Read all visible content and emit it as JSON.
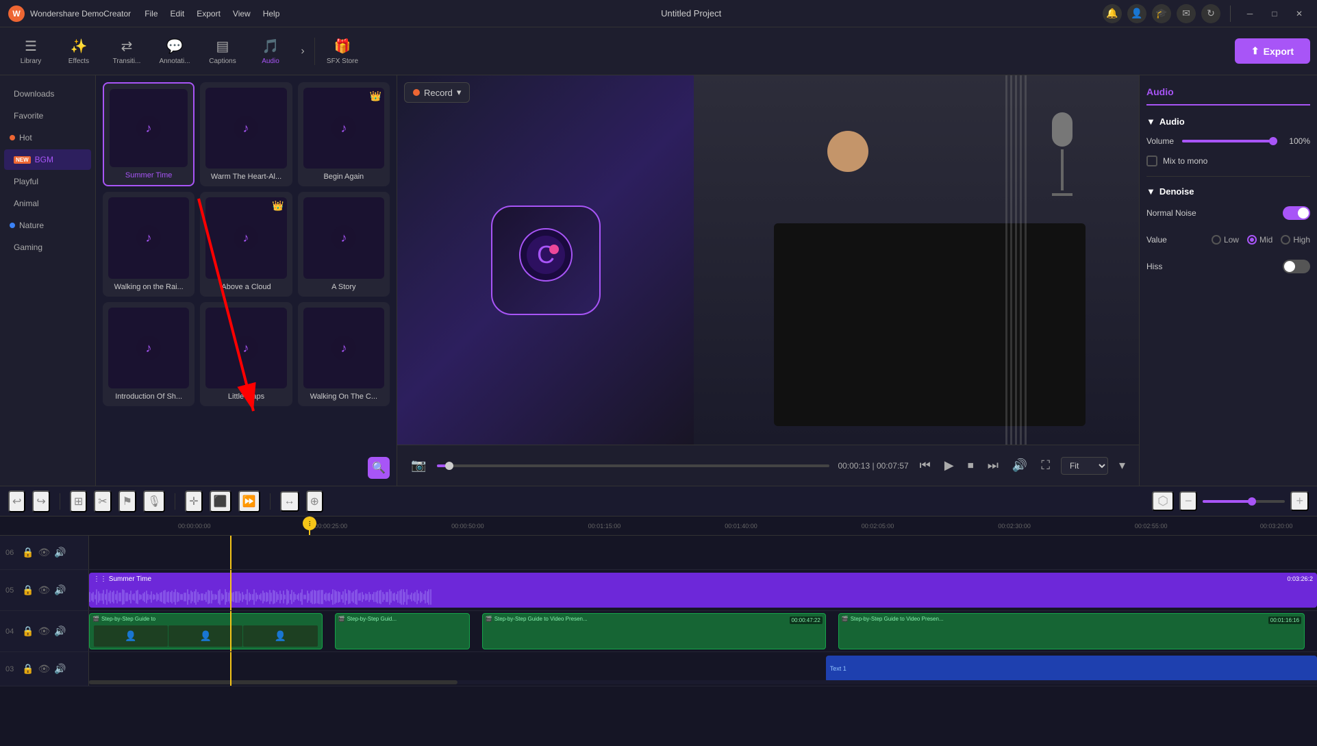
{
  "app": {
    "name": "Wondershare DemoCreator",
    "title": "Untitled Project"
  },
  "titlebar": {
    "menus": [
      "File",
      "Edit",
      "Export",
      "View",
      "Help"
    ],
    "controls": [
      "notification",
      "account",
      "education",
      "mail",
      "refresh"
    ]
  },
  "toolbar": {
    "items": [
      {
        "id": "library",
        "label": "Library",
        "icon": "☰"
      },
      {
        "id": "effects",
        "label": "Effects",
        "icon": "✨"
      },
      {
        "id": "transitions",
        "label": "Transiti...",
        "icon": "⇄"
      },
      {
        "id": "annotations",
        "label": "Annotati...",
        "icon": "💬"
      },
      {
        "id": "captions",
        "label": "Captions",
        "icon": "▤"
      },
      {
        "id": "audio",
        "label": "Audio",
        "icon": "🎵"
      },
      {
        "id": "sfx",
        "label": "SFX Store",
        "icon": "🎁"
      }
    ],
    "export_label": "Export"
  },
  "sidebar": {
    "items": [
      {
        "id": "downloads",
        "label": "Downloads",
        "badge": null
      },
      {
        "id": "favorite",
        "label": "Favorite",
        "badge": null
      },
      {
        "id": "hot",
        "label": "Hot",
        "badge": "dot"
      },
      {
        "id": "bgm",
        "label": "BGM",
        "badge": "new"
      },
      {
        "id": "playful",
        "label": "Playful",
        "badge": null
      },
      {
        "id": "animal",
        "label": "Animal",
        "badge": null
      },
      {
        "id": "nature",
        "label": "Nature",
        "badge": "blue"
      },
      {
        "id": "gaming",
        "label": "Gaming",
        "badge": null
      }
    ]
  },
  "audio_cards": [
    {
      "id": "summer-time",
      "label": "Summer Time",
      "selected": true,
      "crown": false
    },
    {
      "id": "warm-the-heart",
      "label": "Warm The Heart-Al...",
      "selected": false,
      "crown": false
    },
    {
      "id": "begin-again",
      "label": "Begin Again",
      "selected": false,
      "crown": true
    },
    {
      "id": "walking-on-the-rain",
      "label": "Walking on the Rai...",
      "selected": false,
      "crown": false
    },
    {
      "id": "above-a-cloud",
      "label": "Above a Cloud",
      "selected": false,
      "crown": true
    },
    {
      "id": "a-story",
      "label": "A Story",
      "selected": false,
      "crown": false
    },
    {
      "id": "introduction-of-sh",
      "label": "Introduction Of Sh...",
      "selected": false,
      "crown": false
    },
    {
      "id": "little-maps",
      "label": "Little Maps",
      "selected": false,
      "crown": false
    },
    {
      "id": "walking-on-the-c",
      "label": "Walking On The C...",
      "selected": false,
      "crown": false
    }
  ],
  "preview": {
    "record_label": "Record",
    "timestamp_current": "00:00:13",
    "timestamp_total": "00:07:57",
    "fit_label": "Fit"
  },
  "right_panel": {
    "header": "Audio",
    "audio_section": {
      "title": "Audio",
      "volume_label": "Volume",
      "volume_value": "100%",
      "mix_to_mono_label": "Mix to mono"
    },
    "denoise_section": {
      "title": "Denoise",
      "normal_noise_label": "Normal Noise",
      "value_label": "Value",
      "value_options": [
        "Low",
        "Mid",
        "High"
      ],
      "value_selected": "Mid",
      "hiss_label": "Hiss"
    }
  },
  "timeline": {
    "ruler_marks": [
      "00:00:00:00",
      "00:00:25:00",
      "00:00:50:00",
      "00:01:15:00",
      "00:01:40:00",
      "00:02:05:00",
      "00:02:30:00",
      "00:02:55:00",
      "00:03:20:00"
    ],
    "tracks": [
      {
        "num": "06",
        "type": "empty"
      },
      {
        "num": "05",
        "type": "audio",
        "clip_label": "Summer Time",
        "clip_duration": "0:03:26:2"
      },
      {
        "num": "04",
        "type": "video",
        "clips": [
          {
            "label": "Step-by-Step Guide to",
            "start_pct": 0,
            "width_pct": 20,
            "time": ""
          },
          {
            "label": "Step-by-Step Guid...",
            "start_pct": 21,
            "width_pct": 12,
            "time": ""
          },
          {
            "label": "Step-by-Step Guide to Video Presen...",
            "start_pct": 34,
            "width_pct": 28,
            "time": "00:00:47:22"
          },
          {
            "label": "Step-by-Step Guide to Video Presen...",
            "start_pct": 63,
            "width_pct": 37,
            "time": "00:01:16:16"
          }
        ]
      },
      {
        "num": "03",
        "type": "text",
        "clips": [
          {
            "label": "Text 1",
            "start_pct": 60,
            "width_pct": 40
          }
        ]
      }
    ],
    "playhead_position": "11.5%"
  },
  "arrow": {
    "description": "Red arrow from audio card to timeline"
  }
}
